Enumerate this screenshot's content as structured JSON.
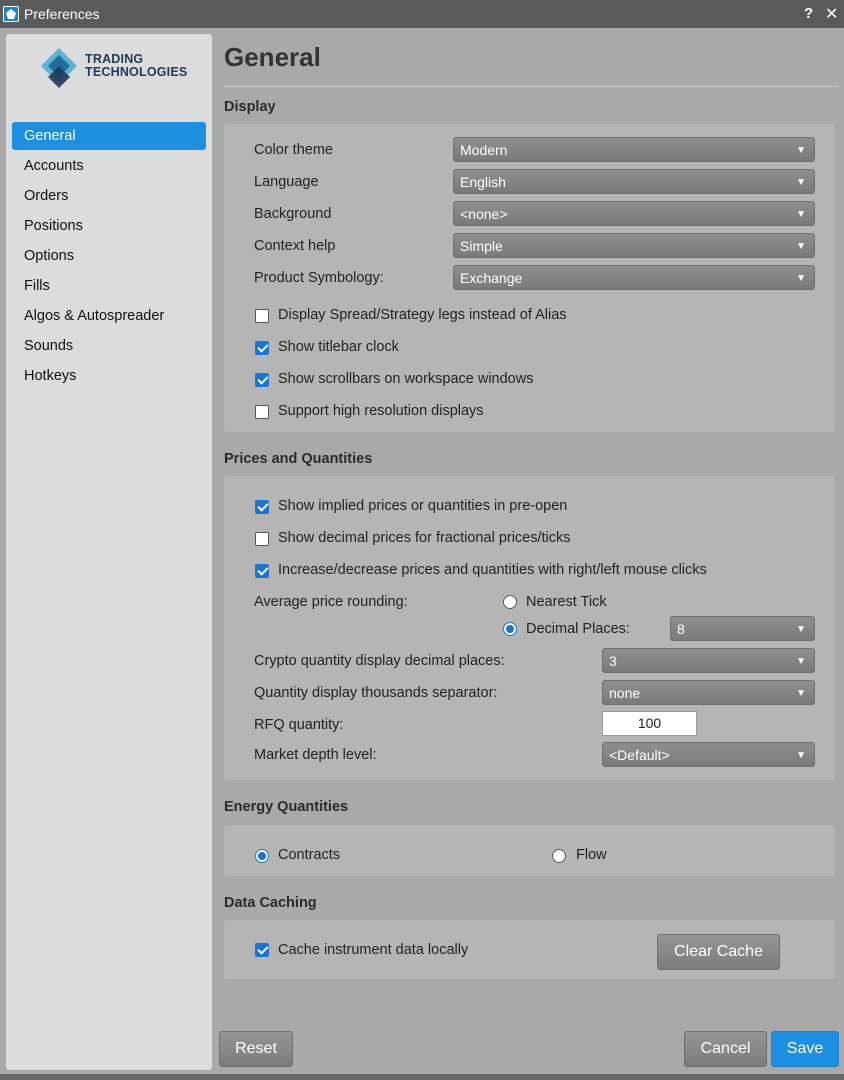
{
  "window": {
    "title": "Preferences",
    "help": "?",
    "close": "✕"
  },
  "logo": {
    "line1": "TRADING",
    "line2": "TECHNOLOGIES"
  },
  "sidebar": {
    "items": [
      {
        "label": "General",
        "active": true
      },
      {
        "label": "Accounts"
      },
      {
        "label": "Orders"
      },
      {
        "label": "Positions"
      },
      {
        "label": "Options"
      },
      {
        "label": "Fills"
      },
      {
        "label": "Algos & Autospreader"
      },
      {
        "label": "Sounds"
      },
      {
        "label": "Hotkeys"
      }
    ]
  },
  "page": {
    "title": "General"
  },
  "display": {
    "heading": "Display",
    "color_theme": {
      "label": "Color theme",
      "value": "Modern"
    },
    "language": {
      "label": "Language",
      "value": "English"
    },
    "background": {
      "label": "Background",
      "value": "<none>"
    },
    "context_help": {
      "label": "Context help",
      "value": "Simple"
    },
    "product_symbology": {
      "label": "Product Symbology:",
      "value": "Exchange"
    },
    "spread_legs": {
      "label": "Display Spread/Strategy legs instead of Alias",
      "checked": false
    },
    "titlebar_clock": {
      "label": "Show titlebar clock",
      "checked": true
    },
    "scrollbars": {
      "label": "Show scrollbars on workspace windows",
      "checked": true
    },
    "high_res": {
      "label": "Support high resolution displays",
      "checked": false
    }
  },
  "prices": {
    "heading": "Prices and Quantities",
    "implied": {
      "label": "Show implied prices or quantities in pre-open",
      "checked": true
    },
    "decimal": {
      "label": "Show decimal prices for fractional prices/ticks",
      "checked": false
    },
    "mouse": {
      "label": "Increase/decrease prices and quantities with right/left mouse clicks",
      "checked": true
    },
    "avg_rounding": {
      "label": "Average price rounding:",
      "nearest_tick": "Nearest Tick",
      "decimal_places": "Decimal Places:",
      "decimal_value": "8",
      "selected": "decimal_places"
    },
    "crypto": {
      "label": "Crypto quantity display decimal places:",
      "value": "3"
    },
    "thousands": {
      "label": "Quantity display thousands separator:",
      "value": "none"
    },
    "rfq": {
      "label": "RFQ quantity:",
      "value": "100"
    },
    "depth": {
      "label": "Market depth level:",
      "value": "<Default>"
    }
  },
  "energy": {
    "heading": "Energy Quantities",
    "contracts": "Contracts",
    "flow": "Flow",
    "selected": "contracts"
  },
  "caching": {
    "heading": "Data Caching",
    "cache_local": {
      "label": "Cache instrument data locally",
      "checked": true
    },
    "clear_button": "Clear Cache"
  },
  "footer": {
    "reset": "Reset",
    "cancel": "Cancel",
    "save": "Save"
  },
  "colors": {
    "accent": "#1c8fe0",
    "checkbox": "#1a74d6"
  },
  "icons": {
    "caret": "▼"
  }
}
